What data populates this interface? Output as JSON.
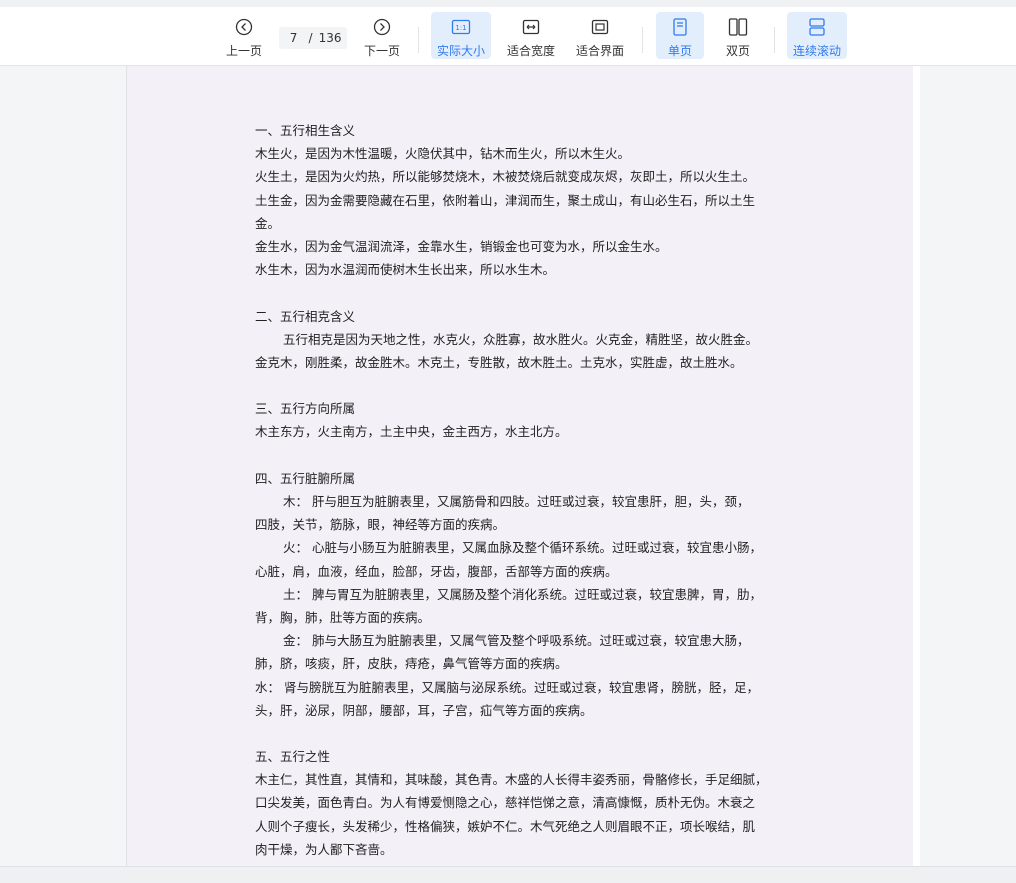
{
  "toolbar": {
    "prev_label": "上一页",
    "next_label": "下一页",
    "current_page": "7",
    "total_pages": "136",
    "actual_size_label": "实际大小",
    "fit_width_label": "适合宽度",
    "fit_page_label": "适合界面",
    "single_page_label": "单页",
    "double_page_label": "双页",
    "continuous_scroll_label": "连续滚动",
    "icons": {
      "prev": "chevron-left-circle-icon",
      "next": "chevron-right-circle-icon",
      "actual_size": "one-to-one-icon",
      "fit_width": "fit-width-icon",
      "fit_page": "fit-page-icon",
      "single_page": "single-page-icon",
      "double_page": "double-page-icon",
      "continuous_scroll": "continuous-scroll-icon"
    },
    "accent_color": "#2f7bf0",
    "active_bg_color": "#e3eefc"
  },
  "document": {
    "lines": [
      "一、五行相生含义",
      "木生火，是因为木性温暖，火隐伏其中，钻木而生火，所以木生火。",
      "火生土，是因为火灼热，所以能够焚烧木，木被焚烧后就变成灰烬，灰即土，所以火生土。",
      "土生金，因为金需要隐藏在石里，依附着山，津润而生，聚土成山，有山必生石，所以土生",
      "金。",
      "金生水，因为金气温润流泽，金靠水生，销锻金也可变为水，所以金生水。",
      "水生木，因为水温润而使树木生长出来，所以水生木。",
      "",
      "二、五行相克含义",
      "五行相克是因为天地之性，水克火，众胜寡，故水胜火。火克金，精胜坚，故火胜金。",
      "金克木，刚胜柔，故金胜木。木克土，专胜散，故木胜土。土克水，实胜虚，故土胜水。",
      "",
      "三、五行方向所属",
      "木主东方，火主南方，土主中央，金主西方，水主北方。",
      "",
      "四、五行脏腑所属",
      "木：  肝与胆互为脏腑表里，又属筋骨和四肢。过旺或过衰，较宜患肝，胆，头，颈，",
      "四肢，关节，筋脉，眼，神经等方面的疾病。",
      "火：  心脏与小肠互为脏腑表里，又属血脉及整个循环系统。过旺或过衰，较宜患小肠，",
      "心脏，肩，血液，经血，脸部，牙齿，腹部，舌部等方面的疾病。",
      "土：  脾与胃互为脏腑表里，又属肠及整个消化系统。过旺或过衰，较宜患脾，胃，肋，",
      "背，胸，肺，肚等方面的疾病。",
      "金：  肺与大肠互为脏腑表里，又属气管及整个呼吸系统。过旺或过衰，较宜患大肠，",
      "肺，脐，咳痰，肝，皮肤，痔疮，鼻气管等方面的疾病。",
      "水：  肾与膀胱互为脏腑表里，又属脑与泌尿系统。过旺或过衰，较宜患肾，膀胱，胫，足，",
      "头，肝，泌尿，阴部，腰部，耳，子宫，疝气等方面的疾病。",
      "",
      "五、五行之性",
      "木主仁，其性直，其情和，其味酸，其色青。木盛的人长得丰姿秀丽，骨骼修长，手足细腻，",
      "口尖发美，面色青白。为人有博爱恻隐之心，慈祥恺悌之意，清高慷慨，质朴无伪。木衰之",
      "人则个子瘦长，头发稀少，性格偏狭，嫉妒不仁。木气死绝之人则眉眼不正，项长喉结，肌",
      "肉干燥，为人鄙下吝啬。"
    ]
  }
}
